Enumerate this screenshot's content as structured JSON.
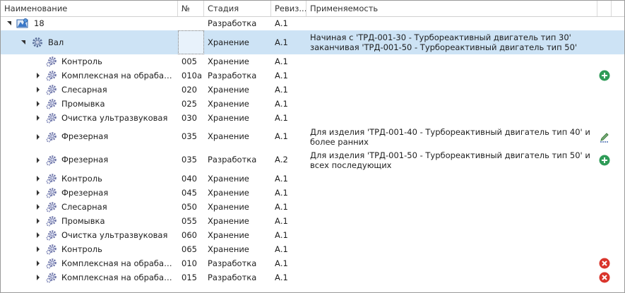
{
  "columns": [
    {
      "label": "Наименование"
    },
    {
      "label": "№"
    },
    {
      "label": "Стадия"
    },
    {
      "label": "Ревиз..."
    },
    {
      "label": "Применяемость"
    }
  ],
  "root": {
    "name": "18",
    "stage": "Разработка",
    "rev": "А.1"
  },
  "part": {
    "name": "Вал",
    "num": "",
    "stage": "Хранение",
    "rev": "А.1",
    "applic": "Начиная с 'ТРД-001-30 - Турбореактивный двигатель тип 30' заканчивая 'ТРД-001-50 - Турбореактивный двигатель тип 50'"
  },
  "ops": [
    {
      "name": "Контроль",
      "num": "005",
      "stage": "Хранение",
      "rev": "А.1",
      "applic": "",
      "expander": false,
      "action": ""
    },
    {
      "name": "Комплексная на обрабаты...",
      "num": "010а",
      "stage": "Разработка",
      "rev": "А.1",
      "applic": "",
      "expander": true,
      "action": "add-icon"
    },
    {
      "name": "Слесарная",
      "num": "020",
      "stage": "Хранение",
      "rev": "А.1",
      "applic": "",
      "expander": true,
      "action": ""
    },
    {
      "name": "Промывка",
      "num": "025",
      "stage": "Хранение",
      "rev": "А.1",
      "applic": "",
      "expander": true,
      "action": ""
    },
    {
      "name": "Очистка ультразвуковая",
      "num": "030",
      "stage": "Хранение",
      "rev": "А.1",
      "applic": "",
      "expander": true,
      "action": ""
    },
    {
      "name": "Фрезерная",
      "num": "035",
      "stage": "Хранение",
      "rev": "А.1",
      "applic": "Для изделия 'ТРД-001-40 - Турбореактивный двигатель тип 40' и более ранних",
      "expander": true,
      "action": "edit-icon"
    },
    {
      "name": "Фрезерная",
      "num": "035",
      "stage": "Разработка",
      "rev": "А.2",
      "applic": "Для изделия 'ТРД-001-50 - Турбореактивный двигатель тип 50' и всех последующих",
      "expander": true,
      "action": "add-icon"
    },
    {
      "name": "Контроль",
      "num": "040",
      "stage": "Хранение",
      "rev": "А.1",
      "applic": "",
      "expander": true,
      "action": ""
    },
    {
      "name": "Фрезерная",
      "num": "045",
      "stage": "Хранение",
      "rev": "А.1",
      "applic": "",
      "expander": true,
      "action": ""
    },
    {
      "name": "Слесарная",
      "num": "050",
      "stage": "Хранение",
      "rev": "А.1",
      "applic": "",
      "expander": true,
      "action": ""
    },
    {
      "name": "Промывка",
      "num": "055",
      "stage": "Хранение",
      "rev": "А.1",
      "applic": "",
      "expander": true,
      "action": ""
    },
    {
      "name": "Очистка ультразвуковая",
      "num": "060",
      "stage": "Хранение",
      "rev": "А.1",
      "applic": "",
      "expander": true,
      "action": ""
    },
    {
      "name": "Контроль",
      "num": "065",
      "stage": "Хранение",
      "rev": "А.1",
      "applic": "",
      "expander": true,
      "action": ""
    },
    {
      "name": "Комплексная на обрабаты...",
      "num": "010",
      "stage": "Разработка",
      "rev": "А.1",
      "applic": "",
      "expander": true,
      "action": "remove-icon"
    },
    {
      "name": "Комплексная на обрабаты...",
      "num": "015",
      "stage": "Разработка",
      "rev": "А.1",
      "applic": "",
      "expander": true,
      "action": "remove-icon"
    }
  ],
  "colors": {
    "selection": "#cde3f5",
    "add": "#2e9b57",
    "remove": "#d9342b",
    "edit": "#3a7a3a"
  }
}
